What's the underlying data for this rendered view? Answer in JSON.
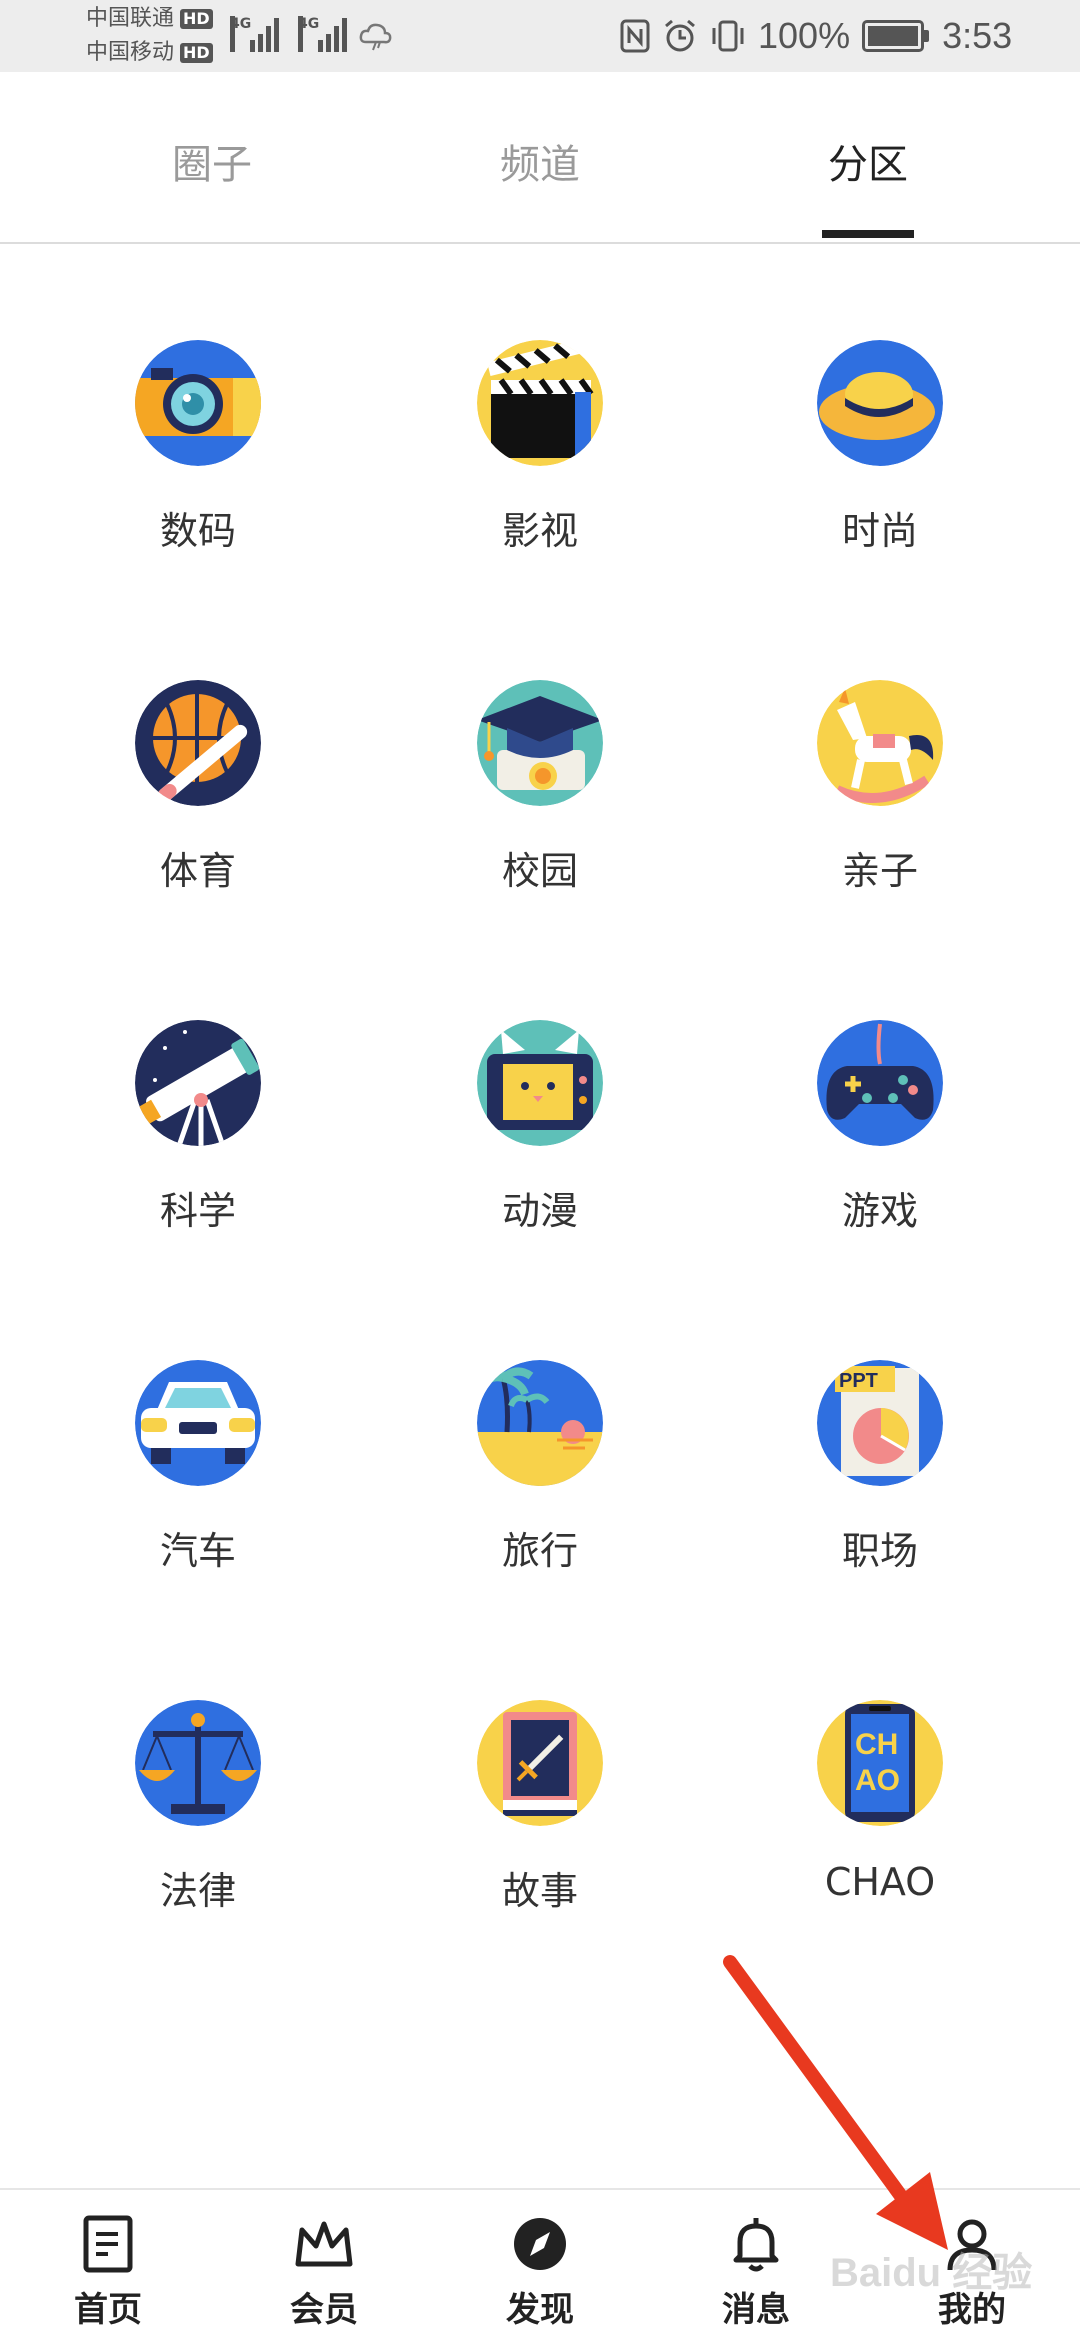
{
  "status_bar": {
    "carrier1": "中国联通",
    "carrier2": "中国移动",
    "hd": "HD",
    "network": "4G",
    "battery": "100%",
    "time": "3:53"
  },
  "tabs": [
    {
      "label": "圈子"
    },
    {
      "label": "频道"
    },
    {
      "label": "分区"
    }
  ],
  "categories": [
    {
      "label": "数码",
      "icon": "camera-icon"
    },
    {
      "label": "影视",
      "icon": "clapperboard-icon"
    },
    {
      "label": "时尚",
      "icon": "hat-icon"
    },
    {
      "label": "体育",
      "icon": "basketball-icon"
    },
    {
      "label": "校园",
      "icon": "graduation-cap-icon"
    },
    {
      "label": "亲子",
      "icon": "rocking-horse-icon"
    },
    {
      "label": "科学",
      "icon": "telescope-icon"
    },
    {
      "label": "动漫",
      "icon": "anime-cat-icon"
    },
    {
      "label": "游戏",
      "icon": "gamepad-icon"
    },
    {
      "label": "汽车",
      "icon": "car-icon"
    },
    {
      "label": "旅行",
      "icon": "beach-icon"
    },
    {
      "label": "职场",
      "icon": "ppt-chart-icon"
    },
    {
      "label": "法律",
      "icon": "scales-icon"
    },
    {
      "label": "故事",
      "icon": "book-icon"
    },
    {
      "label": "CHAO",
      "icon": "chao-phone-icon"
    }
  ],
  "bottom_nav": [
    {
      "label": "首页",
      "icon": "home-doc-icon"
    },
    {
      "label": "会员",
      "icon": "crown-icon"
    },
    {
      "label": "发现",
      "icon": "compass-icon"
    },
    {
      "label": "消息",
      "icon": "bell-icon"
    },
    {
      "label": "我的",
      "icon": "person-icon"
    }
  ],
  "watermark": "Baidu 经验"
}
